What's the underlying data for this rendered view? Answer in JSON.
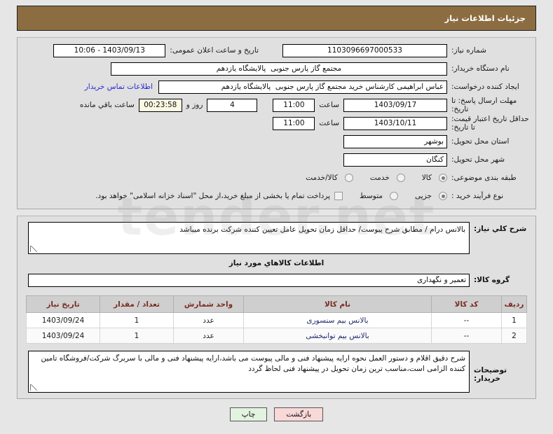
{
  "header": {
    "title": "جزئیات اطلاعات نیاز",
    "bg_color": "#8c6d41",
    "text_color": "#ffffff"
  },
  "form": {
    "need_number": {
      "label": "شماره نیاز:",
      "value": "1103096697000533"
    },
    "announce_datetime": {
      "label": "تاریخ و ساعت اعلان عمومی:",
      "value": "1403/09/13 - 10:06"
    },
    "buyer_org": {
      "label": "نام دستگاه خریدار:",
      "value": "مجتمع گاز پارس جنوبی  پالایشگاه یازدهم"
    },
    "requester": {
      "label": "ایجاد کننده درخواست:",
      "value": "عباس ابراهیمی کارشناس خرید مجتمع گاز پارس جنوبی  پالایشگاه یازدهم"
    },
    "contact_link": {
      "label": "اطلاعات تماس خریدار",
      "color": "#2a2ad0"
    },
    "response_deadline": {
      "label": "مهلت ارسال پاسخ: تا تاریخ:",
      "date": "1403/09/17",
      "time_label": "ساعت",
      "time": "11:00",
      "days_value": "4",
      "days_label": "روز و",
      "countdown": "00:23:58",
      "countdown_label": "ساعت باقي مانده"
    },
    "price_validity": {
      "label": "حداقل تاریخ اعتبار قیمت: تا تاریخ:",
      "date": "1403/10/11",
      "time_label": "ساعت",
      "time": "11:00"
    },
    "delivery_province": {
      "label": "استان محل تحویل:",
      "value": "بوشهر"
    },
    "delivery_city": {
      "label": "شهر محل تحویل:",
      "value": "کنگان"
    },
    "subject_category": {
      "label": "طبقه بندی موضوعی:",
      "options": [
        "کالا",
        "خدمت",
        "کالا/خدمت"
      ],
      "selected": "کالا"
    },
    "purchase_type": {
      "label": "نوع فرآیند خرید :",
      "options": [
        "جزیی",
        "متوسط"
      ],
      "selected": "جزیی"
    },
    "treasury_checkbox": {
      "label": "پرداخت تمام یا بخشی از مبلغ خرید،از محل \"اسناد خزانه اسلامی\" خواهد بود.",
      "checked": false
    }
  },
  "general_need": {
    "label": "شرح كلي نياز:",
    "value": "بالانس درام / مطابق شرح پیوست/ حداقل زمان تحویل عامل تعیین کننده شرکت برنده میباشد"
  },
  "goods_section": {
    "heading": "اطلاعات کالاهاي مورد نیاز",
    "group_label": "گروه کالا:",
    "group_value": "تعمیر و نگهداری",
    "table": {
      "columns": [
        "ردیف",
        "کد کالا",
        "نام کالا",
        "واحد شمارش",
        "تعداد / مقدار",
        "تاریخ نیاز"
      ],
      "rows": [
        {
          "index": "1",
          "code": "--",
          "name": "بالانس بیم سنسوری",
          "unit": "عدد",
          "qty": "1",
          "date": "1403/09/24"
        },
        {
          "index": "2",
          "code": "--",
          "name": "بالانس بیم توانبخشی",
          "unit": "عدد",
          "qty": "1",
          "date": "1403/09/24"
        }
      ]
    }
  },
  "buyer_notes": {
    "label": "توضیحات خریدار:",
    "value": "شرح دقیق اقلام و دستور العمل نحوه ارایه پیشنهاد فنی و مالی پیوست می باشد،ارایه پیشنهاد فنی و مالی با سربرگ شرکت/فروشگاه تامین کننده الزامی است،مناسب ترین زمان تحویل در پیشنهاد فنی لحاظ گردد"
  },
  "footer": {
    "back_button": "بازگشت",
    "print_button": "چاپ"
  }
}
